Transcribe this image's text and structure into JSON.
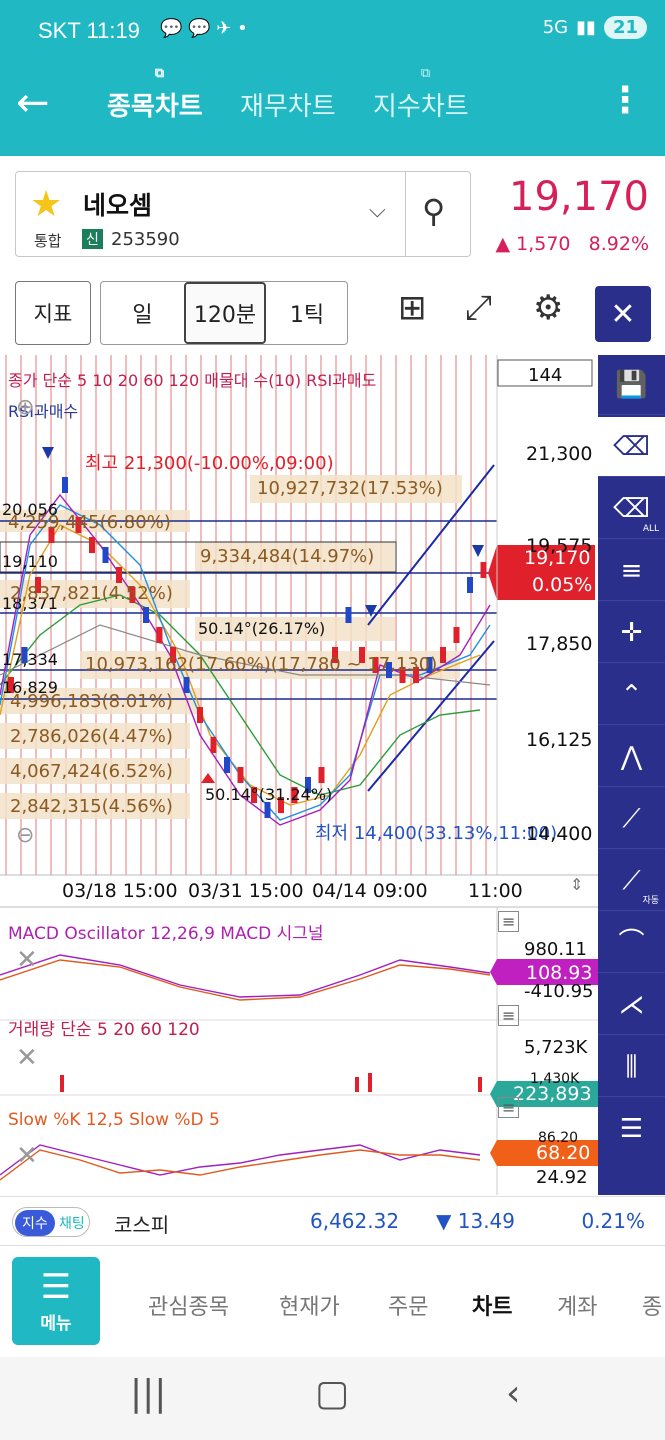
{
  "status": {
    "carrier_time": "SKT 11:19",
    "network": "5G",
    "battery": "21"
  },
  "appbar": {
    "tabs": [
      {
        "label": "종목차트"
      },
      {
        "label": "재무차트"
      },
      {
        "label": "지수차트"
      }
    ]
  },
  "stock": {
    "name": "네오셈",
    "market": "통합",
    "badge": "신",
    "code": "253590",
    "price": "19,170",
    "change": "▲ 1,570",
    "change_pct": "8.92%"
  },
  "toolbar": {
    "indicator": "지표",
    "periods": [
      "일",
      "120분",
      "1틱"
    ],
    "selected_period": "120분"
  },
  "chart": {
    "zoom_count": "144",
    "legend_main": "종가 단순 5 10 20 60 120 매물대 수(10) RSI과매도",
    "legend_main2": "RSI과매수",
    "high_label": "최고 21,300(-10.00%,09:00)",
    "low_label": "최저 14,400(33.13%,11:00)",
    "price_axis": [
      "21,300",
      "19,575",
      "17,850",
      "16,125",
      "14,400"
    ],
    "left_levels": [
      "20,056",
      "19,110",
      "18,371",
      "17,334",
      "16,829"
    ],
    "volume_profile": [
      "10,927,732(17.53%)",
      "4,259,445(6.80%)",
      "9,334,484(14.97%)",
      "2,837,821(4.52%)",
      "50.14°(26.17%)",
      "10,973,162(17.60%)(17,780 ~ 17,130)",
      "4,996,183(8.01%)",
      "2,786,026(4.47%)",
      "4,067,424(6.52%)",
      "2,842,315(4.56%)",
      "50.14°(31.24%)"
    ],
    "price_tag": "19,170",
    "price_tag_pct": "0.05%",
    "x_axis": [
      "03/18 15:00",
      "03/31 15:00",
      "04/14 09:00",
      "11:00"
    ],
    "macd_label": "MACD Oscillator 12,26,9 MACD 시그널",
    "macd_axis": [
      "980.11",
      "-410.95"
    ],
    "macd_tag": "108.93",
    "volume_label": "거래량 단순 5 20 60 120",
    "volume_axis": [
      "5,723K",
      "1,430K"
    ],
    "volume_tag": "223,893",
    "stoch_label": "Slow %K 12,5 Slow %D 5",
    "stoch_axis": [
      "86.20",
      "24.92"
    ],
    "stoch_tag": "68.20",
    "colors": {
      "up": "#e0202a",
      "down": "#2048c8",
      "accent": "#1fb8c3",
      "sidebar": "#2a2f8c"
    }
  },
  "index": {
    "badge1": "지수",
    "badge2": "채팅",
    "name": "코스피",
    "value": "6,462.32",
    "change": "▼ 13.49",
    "pct": "0.21%"
  },
  "bottomnav": {
    "menu": "메뉴",
    "items": [
      "관심종목",
      "현재가",
      "주문",
      "차트",
      "계좌",
      "종"
    ],
    "active": "차트"
  }
}
